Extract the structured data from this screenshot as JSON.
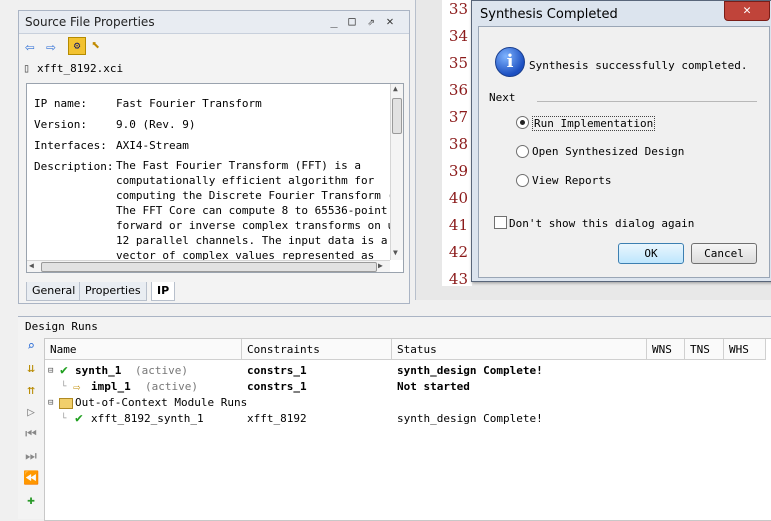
{
  "source_panel": {
    "title": "Source File Properties",
    "file_name": "xfft_8192.xci",
    "props": [
      {
        "label": "IP name:",
        "value": "Fast Fourier Transform"
      },
      {
        "label": "Version:",
        "value": "9.0 (Rev. 9)"
      },
      {
        "label": "Interfaces:",
        "value": "AXI4-Stream"
      }
    ],
    "description_label": "Description:",
    "description": "The Fast Fourier Transform (FFT) is a\ncomputationally efficient algorithm for\ncomputing the Discrete Fourier Transform (DFT).\nThe FFT Core can compute 8 to 65536-point\nforward or inverse complex transforms on up to\n12 parallel channels. The input data is a\nvector of complex values represented as",
    "tabs": [
      "General",
      "Properties",
      "IP"
    ],
    "active_tab": "IP",
    "window_controls": [
      "_",
      "□",
      "⇗",
      "✕"
    ]
  },
  "editor": {
    "line_numbers": [
      "33",
      "34",
      "35",
      "36",
      "37",
      "38",
      "39",
      "40",
      "41",
      "42",
      "43"
    ]
  },
  "dialog": {
    "title": "Synthesis Completed",
    "close_label": "✕",
    "message": "Synthesis successfully completed.",
    "next_label": "Next",
    "options": [
      {
        "label": "Run Implementation",
        "selected": true
      },
      {
        "label": "Open Synthesized Design",
        "selected": false
      },
      {
        "label": "View Reports",
        "selected": false
      }
    ],
    "dont_show_label": "Don't show this dialog again",
    "ok_label": "OK",
    "cancel_label": "Cancel"
  },
  "design_runs": {
    "title": "Design Runs",
    "columns": [
      "Name",
      "Constraints",
      "Status",
      "WNS",
      "TNS",
      "WHS"
    ],
    "rows": [
      {
        "name": "synth_1",
        "tag": "(active)",
        "constraints": "constrs_1",
        "status": "synth_design Complete!"
      },
      {
        "name": "impl_1",
        "tag": "(active)",
        "constraints": "constrs_1",
        "status": "Not started"
      },
      {
        "name": "Out-of-Context Module Runs",
        "tag": "",
        "constraints": "",
        "status": ""
      },
      {
        "name": "xfft_8192_synth_1",
        "tag": "",
        "constraints": "xfft_8192",
        "status": "synth_design Complete!"
      }
    ]
  },
  "colors": {
    "accent_blue": "#1c4fc1",
    "close_red": "#c0443a",
    "check_green": "#20a020",
    "line_number": "#8b1a1a"
  }
}
